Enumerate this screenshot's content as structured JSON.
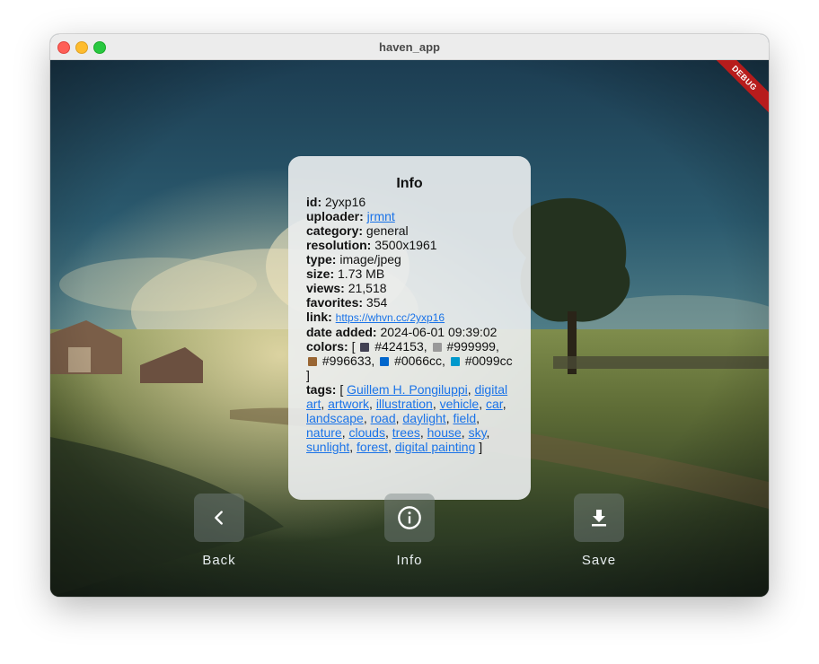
{
  "window": {
    "title": "haven_app"
  },
  "debug_banner": "DEBUG",
  "info": {
    "heading": "Info",
    "id_label": "id:",
    "id": "2yxp16",
    "uploader_label": "uploader:",
    "uploader": "jrmnt",
    "category_label": "category:",
    "category": "general",
    "resolution_label": "resolution:",
    "resolution": "3500x1961",
    "type_label": "type:",
    "type": "image/jpeg",
    "size_label": "size:",
    "size": "1.73 MB",
    "views_label": "views:",
    "views": "21,518",
    "favorites_label": "favorites:",
    "favorites": "354",
    "link_label": "link:",
    "link": "https://whvn.cc/2yxp16",
    "date_label": "date added:",
    "date": "2024-06-01 09:39:02",
    "colors_label": "colors:",
    "colors": [
      {
        "hex": "#424153",
        "label": "#424153"
      },
      {
        "hex": "#999999",
        "label": "#999999"
      },
      {
        "hex": "#996633",
        "label": "#996633"
      },
      {
        "hex": "#0066cc",
        "label": "#0066cc"
      },
      {
        "hex": "#0099cc",
        "label": "#0099cc"
      }
    ],
    "tags_label": "tags:",
    "tags": [
      "Guillem H. Pongiluppi",
      "digital art",
      "artwork",
      "illustration",
      "vehicle",
      "car",
      "landscape",
      "road",
      "daylight",
      "field",
      "nature",
      "clouds",
      "trees",
      "house",
      "sky",
      "sunlight",
      "forest",
      "digital painting"
    ]
  },
  "actions": {
    "back": {
      "label": "Back",
      "icon": "chevron-left-icon"
    },
    "info": {
      "label": "Info",
      "icon": "info-circle-icon"
    },
    "save": {
      "label": "Save",
      "icon": "download-icon"
    }
  }
}
